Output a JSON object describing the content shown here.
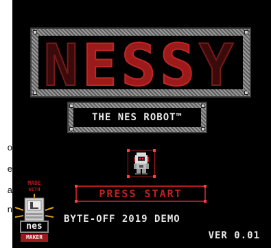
{
  "page_edge_letters": [
    "o",
    "e",
    "a",
    "n"
  ],
  "logo": {
    "title": "NESSY",
    "title_dim_prefix": "N",
    "title_highlight": "ESS",
    "title_dim_suffix": "Y"
  },
  "subtitle": {
    "text": "THE NES ROBOT™"
  },
  "menu": {
    "press_start": "PRESS START"
  },
  "footer": {
    "demo_label": "BYTE-OFF 2019 DEMO",
    "version": "VER 0.01"
  },
  "badge": {
    "line1": "MADE",
    "line2": "WITH",
    "brand": "nes",
    "line3": "MAKER"
  },
  "colors": {
    "background": "#000000",
    "accent_red": "#b01c1c",
    "text": "#e8e8e8",
    "frame_metal": "#8c8c8c"
  },
  "icons": {
    "robot": "robot-sprite-icon",
    "cartridge": "nes-cartridge-icon"
  }
}
